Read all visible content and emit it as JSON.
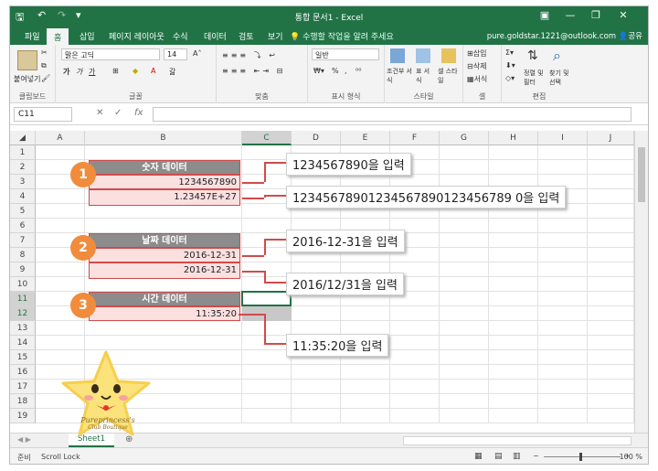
{
  "app": {
    "title": "통합 문서1 - Excel",
    "qa_save": "🖫",
    "qa_undo": "↶",
    "qa_redo": "↷",
    "qa_more": "▾",
    "account": "pure.goldstar.1221@outlook.com",
    "share": "공유",
    "tell_me": "수행할 작업을 알려 주세요"
  },
  "tabs": [
    "파일",
    "홈",
    "삽입",
    "페이지 레이아웃",
    "수식",
    "데이터",
    "검토",
    "보기"
  ],
  "ribbon": {
    "clipboard": {
      "label": "클립보드",
      "paste": "붙여넣기"
    },
    "font": {
      "label": "글꼴",
      "name": "맑은 고딕",
      "size": "14",
      "bold": "가",
      "italic": "가",
      "underline": "가"
    },
    "align": {
      "label": "맞춤"
    },
    "number": {
      "label": "표시 형식",
      "format": "일반",
      "percent": "%",
      "comma": ","
    },
    "style": {
      "label": "스타일",
      "cond": "조건부 서식",
      "table": "표 서식",
      "cell": "셀 스타일"
    },
    "cells": {
      "label": "셀",
      "insert": "삽입",
      "delete": "삭제",
      "format": "서식"
    },
    "edit": {
      "label": "편집",
      "sort": "정렬 및 필터",
      "find": "찾기 및 선택"
    }
  },
  "formula_bar": {
    "name_box": "C11",
    "cancel": "✕",
    "enter": "✓",
    "fx": "fx"
  },
  "columns": [
    "A",
    "B",
    "C",
    "D",
    "E",
    "F",
    "G",
    "H",
    "I",
    "J"
  ],
  "rows": [
    "1",
    "2",
    "3",
    "4",
    "5",
    "6",
    "7",
    "8",
    "9",
    "10",
    "11",
    "12",
    "13",
    "14",
    "15",
    "16",
    "17",
    "18",
    "19"
  ],
  "cells": {
    "b2": "숫자 데이터",
    "b3": "1234567890",
    "b4": "1.23457E+27",
    "b7": "날짜 데이터",
    "b8": "2016-12-31",
    "b9": "2016-12-31",
    "b11": "시간 데이터",
    "b12": "11:35:20"
  },
  "badges": [
    "1",
    "2",
    "3"
  ],
  "callouts": {
    "c1": "1234567890을 입력",
    "c2": "12345678901234567890123456789 0을 입력",
    "c3": "2016-12-31을 입력",
    "c4": "2016/12/31을 입력",
    "c5": "11:35:20을 입력"
  },
  "sheets": [
    "Sheet1"
  ],
  "status": {
    "ready": "준비",
    "scroll_lock": "Scroll Lock",
    "zoom": "100 %"
  },
  "mascot": {
    "line1": "Pureprincess's",
    "line2": "Club Boutique"
  },
  "colors": {
    "excel_green": "#217346",
    "badge": "#f08c3c",
    "cell_fill": "#fbe0e0",
    "cell_border": "#d24a4a",
    "header_fill": "#8c8c8c"
  }
}
